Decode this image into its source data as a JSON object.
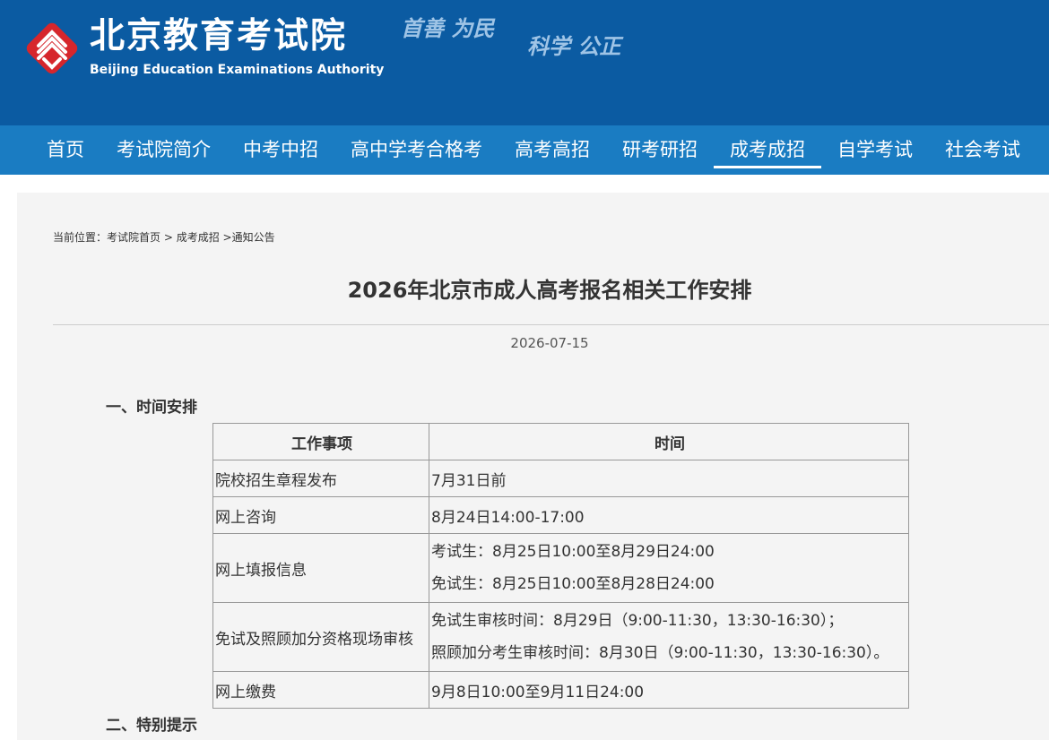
{
  "header": {
    "logo_cn": "北京教育考试院",
    "logo_en": "Beijing Education Examinations Authority",
    "motto_line1": "首善 为民",
    "motto_line2": "科学 公正",
    "bg_color": "#0b5ba2",
    "logo_color": "#d6262c"
  },
  "nav": {
    "items": [
      {
        "label": "首页"
      },
      {
        "label": "考试院简介"
      },
      {
        "label": "中考中招"
      },
      {
        "label": "高中学考合格考"
      },
      {
        "label": "高考高招"
      },
      {
        "label": "研考研招"
      },
      {
        "label": "成考成招",
        "active": true
      },
      {
        "label": "自学考试"
      },
      {
        "label": "社会考试"
      }
    ],
    "bg_color": "#1a7cc2"
  },
  "breadcrumb": {
    "prefix": "当前位置：",
    "items": [
      "考试院首页",
      "成考成招",
      "通知公告"
    ],
    "sep1": " > ",
    "sep2": " >"
  },
  "article": {
    "title": "2026年北京市成人高考报名相关工作安排",
    "date": "2026-07-15",
    "section1": "一、时间安排",
    "section2": "二、特别提示",
    "table": {
      "headers": [
        "工作事项",
        "时间"
      ],
      "rows": [
        {
          "item": "院校招生章程发布",
          "time": [
            "7月31日前"
          ]
        },
        {
          "item": "网上咨询",
          "time": [
            "8月24日14:00-17:00"
          ]
        },
        {
          "item": "网上填报信息",
          "time": [
            "考试生：8月25日10:00至8月29日24:00",
            "免试生：8月25日10:00至8月28日24:00"
          ]
        },
        {
          "item": "免试及照顾加分资格现场审核",
          "time": [
            "免试生审核时间：8月29日（9:00-11:30，13:30-16:30）；",
            "照顾加分考生审核时间：8月30日（9:00-11:30，13:30-16:30）。"
          ]
        },
        {
          "item": "网上缴费",
          "time": [
            "9月8日10:00至9月11日24:00"
          ]
        }
      ]
    }
  }
}
